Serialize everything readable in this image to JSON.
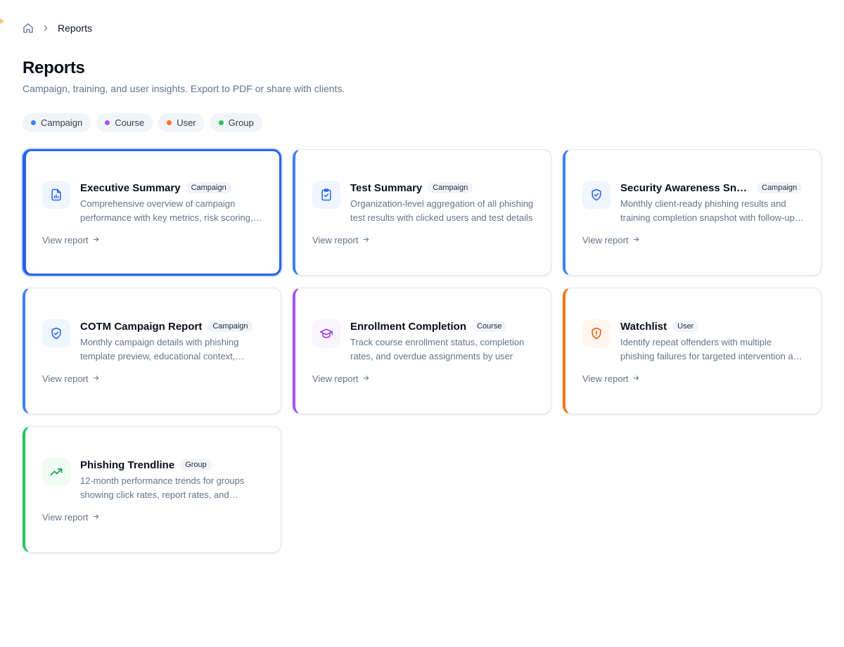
{
  "breadcrumb": {
    "home_icon": "home-icon",
    "separator_icon": "chevron-right-icon",
    "current": "Reports"
  },
  "header": {
    "title": "Reports",
    "subtitle": "Campaign, training, and user insights. Export to PDF or share with clients."
  },
  "filters": [
    {
      "label": "Campaign",
      "color": "#3b82f6"
    },
    {
      "label": "Course",
      "color": "#a855f7"
    },
    {
      "label": "User",
      "color": "#f97316"
    },
    {
      "label": "Group",
      "color": "#22c55e"
    }
  ],
  "colors": {
    "campaign": "#3b82f6",
    "course": "#a855f7",
    "user": "#f97316",
    "group": "#22c55e",
    "selected": "#2563eb"
  },
  "cards": [
    {
      "title": "Executive Summary",
      "badge": "Campaign",
      "description": "Comprehensive overview of campaign performance with key metrics, risk scoring, and recommendations",
      "link": "View report",
      "icon": "document-chart-icon",
      "selected": true
    },
    {
      "title": "Test Summary",
      "badge": "Campaign",
      "description": "Organization-level aggregation of all phishing test results with clicked users and test details",
      "link": "View report",
      "icon": "clipboard-check-icon"
    },
    {
      "title": "Security Awareness Snapshot",
      "badge": "Campaign",
      "description": "Monthly client-ready phishing results and training completion snapshot with follow-up actions",
      "link": "View report",
      "icon": "shield-check-icon"
    },
    {
      "title": "COTM Campaign Report",
      "badge": "Campaign",
      "description": "Monthly campaign details with phishing template preview, educational context, results and more",
      "link": "View report",
      "icon": "shield-check-icon"
    },
    {
      "title": "Enrollment Completion",
      "badge": "Course",
      "description": "Track course enrollment status, completion rates, and overdue assignments by user",
      "link": "View report",
      "icon": "graduation-cap-icon"
    },
    {
      "title": "Watchlist",
      "badge": "User",
      "description": "Identify repeat offenders with multiple phishing failures for targeted intervention and training",
      "link": "View report",
      "icon": "shield-alert-icon"
    },
    {
      "title": "Phishing Trendline",
      "badge": "Group",
      "description": "12-month performance trends for groups showing click rates, report rates, and improvement over time",
      "link": "View report",
      "icon": "trending-up-icon"
    }
  ]
}
